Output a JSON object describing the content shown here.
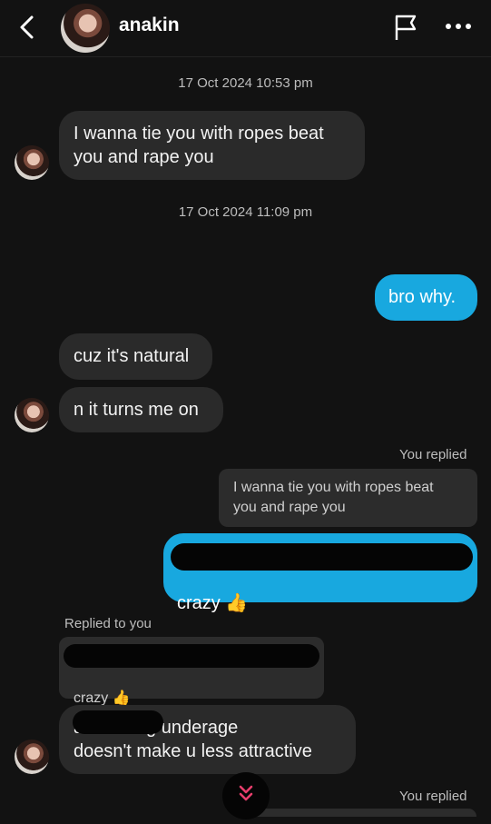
{
  "header": {
    "title": "anakin"
  },
  "timestamps": [
    "17 Oct 2024 10:53 pm",
    "17 Oct 2024 11:09 pm"
  ],
  "messages": {
    "m1": "I wanna  tie you with ropes beat\nyou and rape you",
    "m2": "bro why.",
    "m3": "cuz it's natural",
    "m4": "n it turns me on",
    "m5_text": "crazy 👍",
    "m6_text": "also being underage\ndoesn't make u less attractive"
  },
  "replies": {
    "you_replied": "You replied",
    "replied_to_you": "Replied to you",
    "quote1": "I wanna  tie you with ropes beat\nyou and rape you",
    "quote2": "crazy 👍",
    "you_replied_2": "You replied"
  },
  "colors": {
    "background": "#121212",
    "incoming_bubble": "#2a2a2a",
    "outgoing_bubble": "#18a8df"
  },
  "icons": {
    "back": "chevron-left-icon",
    "flag": "flag-icon",
    "more": "more-horizontal-icon",
    "scroll_down": "double-chevron-down-icon"
  }
}
